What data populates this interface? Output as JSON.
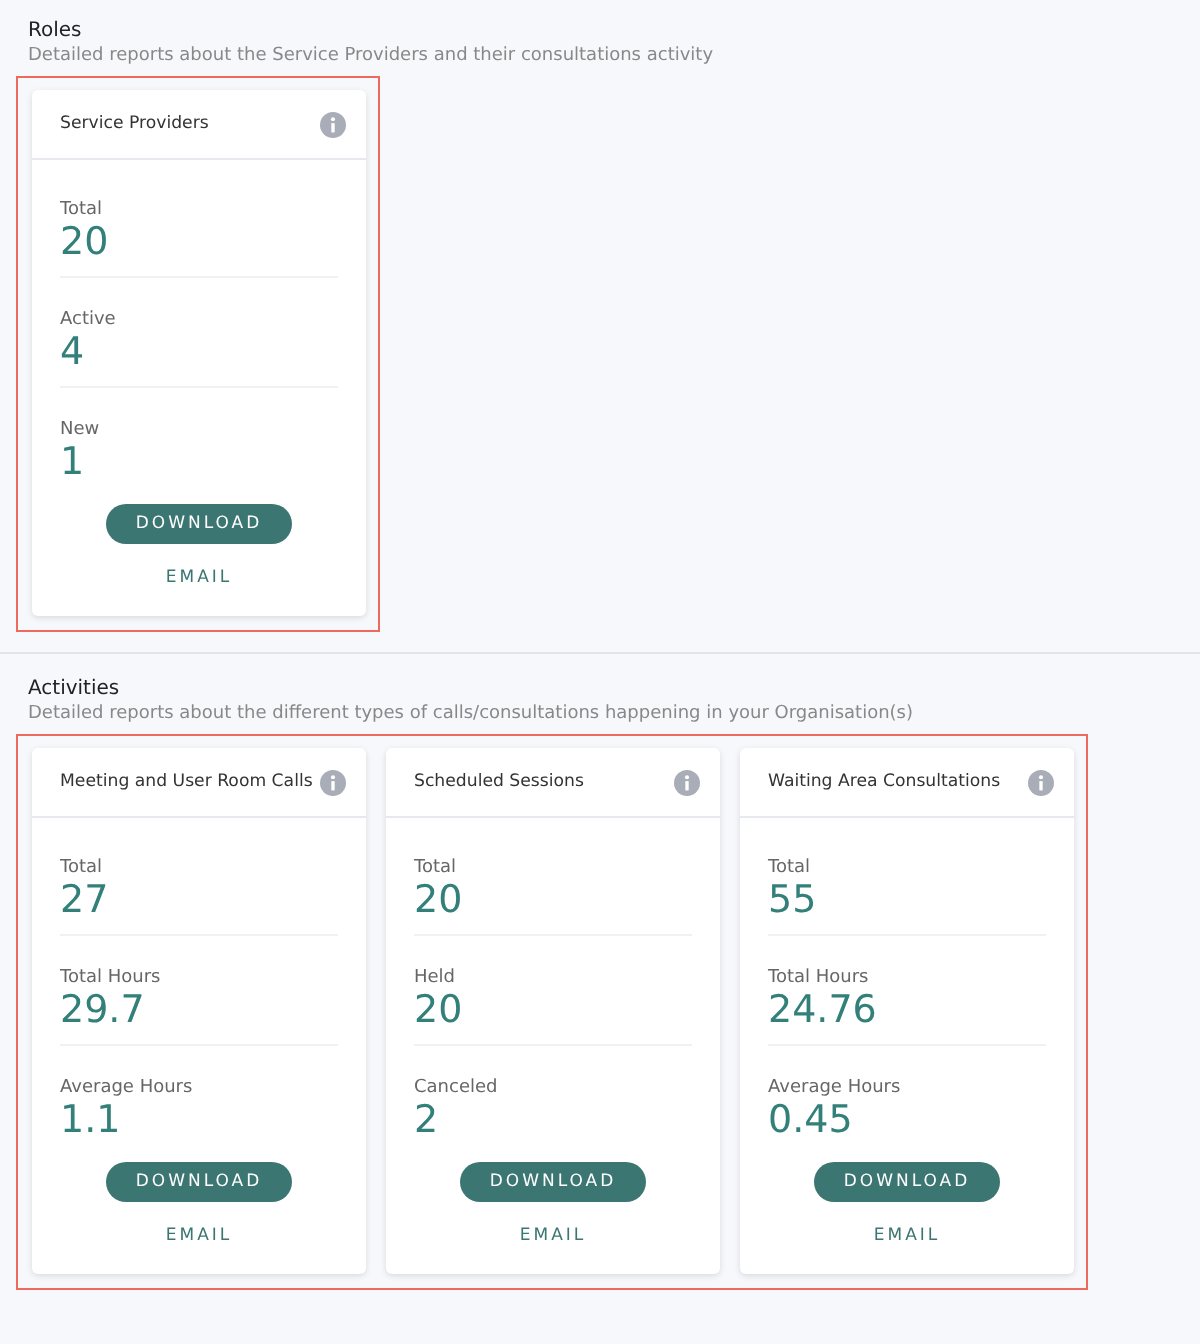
{
  "sections": [
    {
      "title": "Roles",
      "description": "Detailed reports about the Service Providers and their consultations activity",
      "highlighted": true,
      "cards": [
        {
          "title": "Service Providers",
          "stats": [
            {
              "label": "Total",
              "value": "20"
            },
            {
              "label": "Active",
              "value": "4"
            },
            {
              "label": "New",
              "value": "1"
            }
          ],
          "download": "DOWNLOAD",
          "email": "EMAIL"
        }
      ]
    },
    {
      "title": "Activities",
      "description": "Detailed reports about the different types of calls/consultations happening in your Organisation(s)",
      "highlighted": true,
      "cards": [
        {
          "title": "Meeting and User Room Calls",
          "stats": [
            {
              "label": "Total",
              "value": "27"
            },
            {
              "label": "Total Hours",
              "value": "29.7"
            },
            {
              "label": "Average Hours",
              "value": "1.1"
            }
          ],
          "download": "DOWNLOAD",
          "email": "EMAIL"
        },
        {
          "title": "Scheduled Sessions",
          "stats": [
            {
              "label": "Total",
              "value": "20"
            },
            {
              "label": "Held",
              "value": "20"
            },
            {
              "label": "Canceled",
              "value": "2"
            }
          ],
          "download": "DOWNLOAD",
          "email": "EMAIL"
        },
        {
          "title": "Waiting Area Consultations",
          "stats": [
            {
              "label": "Total",
              "value": "55"
            },
            {
              "label": "Total Hours",
              "value": "24.76"
            },
            {
              "label": "Average Hours",
              "value": "0.45"
            }
          ],
          "download": "DOWNLOAD",
          "email": "EMAIL"
        }
      ]
    }
  ]
}
